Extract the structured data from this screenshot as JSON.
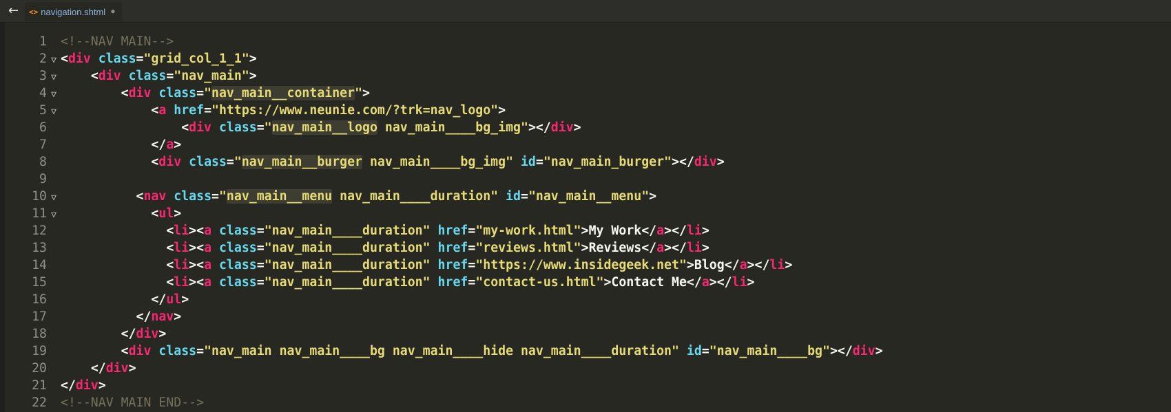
{
  "tab": {
    "title": "navigation.shtml",
    "icon": "code-file-icon",
    "modified": true
  },
  "toolbar": {
    "back_icon": "left-arrow-icon"
  },
  "theme": {
    "background": "#272822",
    "tag": "#f92672",
    "attribute": "#66d9ef",
    "string": "#e6db74",
    "comment": "#75715e",
    "text": "#f8f8f2"
  },
  "code": {
    "lines": [
      {
        "num": "1",
        "fold": false,
        "indent": 0,
        "tokens": [
          {
            "t": "com",
            "v": "<!--NAV MAIN-->"
          }
        ]
      },
      {
        "num": "2",
        "fold": true,
        "indent": 0,
        "tokens": [
          {
            "t": "pun",
            "v": "<"
          },
          {
            "t": "tag",
            "v": "div"
          },
          {
            "t": "pun",
            "v": " "
          },
          {
            "t": "attr",
            "v": "class"
          },
          {
            "t": "pun",
            "v": "="
          },
          {
            "t": "str",
            "v": "\"grid_col_1_1\""
          },
          {
            "t": "pun",
            "v": ">"
          }
        ]
      },
      {
        "num": "3",
        "fold": true,
        "indent": 4,
        "tokens": [
          {
            "t": "pun",
            "v": "<"
          },
          {
            "t": "tag",
            "v": "div"
          },
          {
            "t": "pun",
            "v": " "
          },
          {
            "t": "attr",
            "v": "class"
          },
          {
            "t": "pun",
            "v": "="
          },
          {
            "t": "str",
            "v": "\"nav_main\""
          },
          {
            "t": "pun",
            "v": ">"
          }
        ]
      },
      {
        "num": "4",
        "fold": true,
        "indent": 8,
        "tokens": [
          {
            "t": "pun",
            "v": "<"
          },
          {
            "t": "tag",
            "v": "div"
          },
          {
            "t": "pun",
            "v": " "
          },
          {
            "t": "attr",
            "v": "class"
          },
          {
            "t": "pun",
            "v": "="
          },
          {
            "t": "str",
            "v": "\""
          },
          {
            "t": "str",
            "v": "nav_main__container",
            "hl": true
          },
          {
            "t": "str",
            "v": "\""
          },
          {
            "t": "pun",
            "v": ">"
          }
        ]
      },
      {
        "num": "5",
        "fold": true,
        "indent": 12,
        "tokens": [
          {
            "t": "pun",
            "v": "<"
          },
          {
            "t": "tag",
            "v": "a"
          },
          {
            "t": "pun",
            "v": " "
          },
          {
            "t": "attr",
            "v": "href"
          },
          {
            "t": "pun",
            "v": "="
          },
          {
            "t": "str",
            "v": "\"https://www.neunie.com/?trk=nav_logo\""
          },
          {
            "t": "pun",
            "v": ">"
          }
        ]
      },
      {
        "num": "6",
        "fold": false,
        "indent": 16,
        "tokens": [
          {
            "t": "pun",
            "v": "<"
          },
          {
            "t": "tag",
            "v": "div"
          },
          {
            "t": "pun",
            "v": " "
          },
          {
            "t": "attr",
            "v": "class"
          },
          {
            "t": "pun",
            "v": "="
          },
          {
            "t": "str",
            "v": "\""
          },
          {
            "t": "str",
            "v": "nav_main__logo",
            "hl": true
          },
          {
            "t": "str",
            "v": " nav_main____bg_img\""
          },
          {
            "t": "pun",
            "v": "></"
          },
          {
            "t": "tag",
            "v": "div"
          },
          {
            "t": "pun",
            "v": ">"
          }
        ]
      },
      {
        "num": "7",
        "fold": false,
        "indent": 12,
        "tokens": [
          {
            "t": "pun",
            "v": "</"
          },
          {
            "t": "tag",
            "v": "a"
          },
          {
            "t": "pun",
            "v": ">"
          }
        ]
      },
      {
        "num": "8",
        "fold": false,
        "indent": 12,
        "tokens": [
          {
            "t": "pun",
            "v": "<"
          },
          {
            "t": "tag",
            "v": "div"
          },
          {
            "t": "pun",
            "v": " "
          },
          {
            "t": "attr",
            "v": "class"
          },
          {
            "t": "pun",
            "v": "="
          },
          {
            "t": "str",
            "v": "\""
          },
          {
            "t": "str",
            "v": "nav_main__burger",
            "hl": true
          },
          {
            "t": "str",
            "v": " nav_main____bg_img\""
          },
          {
            "t": "pun",
            "v": " "
          },
          {
            "t": "attr",
            "v": "id"
          },
          {
            "t": "pun",
            "v": "="
          },
          {
            "t": "str",
            "v": "\"nav_main_burger\""
          },
          {
            "t": "pun",
            "v": "></"
          },
          {
            "t": "tag",
            "v": "div"
          },
          {
            "t": "pun",
            "v": ">"
          }
        ]
      },
      {
        "num": "9",
        "fold": false,
        "indent": 0,
        "tokens": []
      },
      {
        "num": "10",
        "fold": true,
        "indent": 10,
        "tokens": [
          {
            "t": "pun",
            "v": "<"
          },
          {
            "t": "tag",
            "v": "nav"
          },
          {
            "t": "pun",
            "v": " "
          },
          {
            "t": "attr",
            "v": "class"
          },
          {
            "t": "pun",
            "v": "="
          },
          {
            "t": "str",
            "v": "\""
          },
          {
            "t": "str",
            "v": "nav_main__menu",
            "hl": true
          },
          {
            "t": "str",
            "v": " nav_main____duration\""
          },
          {
            "t": "pun",
            "v": " "
          },
          {
            "t": "attr",
            "v": "id"
          },
          {
            "t": "pun",
            "v": "="
          },
          {
            "t": "str",
            "v": "\"nav_main__menu\""
          },
          {
            "t": "pun",
            "v": ">"
          }
        ]
      },
      {
        "num": "11",
        "fold": true,
        "indent": 12,
        "tokens": [
          {
            "t": "pun",
            "v": "<"
          },
          {
            "t": "tag",
            "v": "ul"
          },
          {
            "t": "pun",
            "v": ">"
          }
        ]
      },
      {
        "num": "12",
        "fold": false,
        "indent": 14,
        "tokens": [
          {
            "t": "pun",
            "v": "<"
          },
          {
            "t": "tag",
            "v": "li"
          },
          {
            "t": "pun",
            "v": "><"
          },
          {
            "t": "tag",
            "v": "a"
          },
          {
            "t": "pun",
            "v": " "
          },
          {
            "t": "attr",
            "v": "class"
          },
          {
            "t": "pun",
            "v": "="
          },
          {
            "t": "str",
            "v": "\"nav_main____duration\""
          },
          {
            "t": "pun",
            "v": " "
          },
          {
            "t": "attr",
            "v": "href"
          },
          {
            "t": "pun",
            "v": "="
          },
          {
            "t": "str",
            "v": "\"my-work.html\""
          },
          {
            "t": "pun",
            "v": ">"
          },
          {
            "t": "txt",
            "v": "My Work"
          },
          {
            "t": "pun",
            "v": "</"
          },
          {
            "t": "tag",
            "v": "a"
          },
          {
            "t": "pun",
            "v": "></"
          },
          {
            "t": "tag",
            "v": "li"
          },
          {
            "t": "pun",
            "v": ">"
          }
        ]
      },
      {
        "num": "13",
        "fold": false,
        "indent": 14,
        "tokens": [
          {
            "t": "pun",
            "v": "<"
          },
          {
            "t": "tag",
            "v": "li"
          },
          {
            "t": "pun",
            "v": "><"
          },
          {
            "t": "tag",
            "v": "a"
          },
          {
            "t": "pun",
            "v": " "
          },
          {
            "t": "attr",
            "v": "class"
          },
          {
            "t": "pun",
            "v": "="
          },
          {
            "t": "str",
            "v": "\"nav_main____duration\""
          },
          {
            "t": "pun",
            "v": " "
          },
          {
            "t": "attr",
            "v": "href"
          },
          {
            "t": "pun",
            "v": "="
          },
          {
            "t": "str",
            "v": "\"reviews.html\""
          },
          {
            "t": "pun",
            "v": ">"
          },
          {
            "t": "txt",
            "v": "Reviews"
          },
          {
            "t": "pun",
            "v": "</"
          },
          {
            "t": "tag",
            "v": "a"
          },
          {
            "t": "pun",
            "v": "></"
          },
          {
            "t": "tag",
            "v": "li"
          },
          {
            "t": "pun",
            "v": ">"
          }
        ]
      },
      {
        "num": "14",
        "fold": false,
        "indent": 14,
        "tokens": [
          {
            "t": "pun",
            "v": "<"
          },
          {
            "t": "tag",
            "v": "li"
          },
          {
            "t": "pun",
            "v": "><"
          },
          {
            "t": "tag",
            "v": "a"
          },
          {
            "t": "pun",
            "v": " "
          },
          {
            "t": "attr",
            "v": "class"
          },
          {
            "t": "pun",
            "v": "="
          },
          {
            "t": "str",
            "v": "\"nav_main____duration\""
          },
          {
            "t": "pun",
            "v": " "
          },
          {
            "t": "attr",
            "v": "href"
          },
          {
            "t": "pun",
            "v": "="
          },
          {
            "t": "str",
            "v": "\"https://www.insidegeek.net\""
          },
          {
            "t": "pun",
            "v": ">"
          },
          {
            "t": "txt",
            "v": "Blog"
          },
          {
            "t": "pun",
            "v": "</"
          },
          {
            "t": "tag",
            "v": "a"
          },
          {
            "t": "pun",
            "v": "></"
          },
          {
            "t": "tag",
            "v": "li"
          },
          {
            "t": "pun",
            "v": ">"
          }
        ]
      },
      {
        "num": "15",
        "fold": false,
        "indent": 14,
        "tokens": [
          {
            "t": "pun",
            "v": "<"
          },
          {
            "t": "tag",
            "v": "li"
          },
          {
            "t": "pun",
            "v": "><"
          },
          {
            "t": "tag",
            "v": "a"
          },
          {
            "t": "pun",
            "v": " "
          },
          {
            "t": "attr",
            "v": "class"
          },
          {
            "t": "pun",
            "v": "="
          },
          {
            "t": "str",
            "v": "\"nav_main____duration\""
          },
          {
            "t": "pun",
            "v": " "
          },
          {
            "t": "attr",
            "v": "href"
          },
          {
            "t": "pun",
            "v": "="
          },
          {
            "t": "str",
            "v": "\"contact-us.html\""
          },
          {
            "t": "pun",
            "v": ">"
          },
          {
            "t": "txt",
            "v": "Contact Me"
          },
          {
            "t": "pun",
            "v": "</"
          },
          {
            "t": "tag",
            "v": "a"
          },
          {
            "t": "pun",
            "v": "></"
          },
          {
            "t": "tag",
            "v": "li"
          },
          {
            "t": "pun",
            "v": ">"
          }
        ]
      },
      {
        "num": "16",
        "fold": false,
        "indent": 12,
        "tokens": [
          {
            "t": "pun",
            "v": "</"
          },
          {
            "t": "tag",
            "v": "ul"
          },
          {
            "t": "pun",
            "v": ">"
          }
        ]
      },
      {
        "num": "17",
        "fold": false,
        "indent": 10,
        "tokens": [
          {
            "t": "pun",
            "v": "</"
          },
          {
            "t": "tag",
            "v": "nav"
          },
          {
            "t": "pun",
            "v": ">"
          }
        ]
      },
      {
        "num": "18",
        "fold": false,
        "indent": 8,
        "tokens": [
          {
            "t": "pun",
            "v": "</"
          },
          {
            "t": "tag",
            "v": "div"
          },
          {
            "t": "pun",
            "v": ">"
          }
        ]
      },
      {
        "num": "19",
        "fold": false,
        "indent": 8,
        "tokens": [
          {
            "t": "pun",
            "v": "<"
          },
          {
            "t": "tag",
            "v": "div"
          },
          {
            "t": "pun",
            "v": " "
          },
          {
            "t": "attr",
            "v": "class"
          },
          {
            "t": "pun",
            "v": "="
          },
          {
            "t": "str",
            "v": "\"nav_main nav_main____bg nav_main____hide nav_main____duration\""
          },
          {
            "t": "pun",
            "v": " "
          },
          {
            "t": "attr",
            "v": "id"
          },
          {
            "t": "pun",
            "v": "="
          },
          {
            "t": "str",
            "v": "\"nav_main____bg\""
          },
          {
            "t": "pun",
            "v": "></"
          },
          {
            "t": "tag",
            "v": "div"
          },
          {
            "t": "pun",
            "v": ">"
          }
        ]
      },
      {
        "num": "20",
        "fold": false,
        "indent": 4,
        "tokens": [
          {
            "t": "pun",
            "v": "</"
          },
          {
            "t": "tag",
            "v": "div"
          },
          {
            "t": "pun",
            "v": ">"
          }
        ]
      },
      {
        "num": "21",
        "fold": false,
        "indent": 0,
        "tokens": [
          {
            "t": "pun",
            "v": "</"
          },
          {
            "t": "tag",
            "v": "div"
          },
          {
            "t": "pun",
            "v": ">"
          }
        ]
      },
      {
        "num": "22",
        "fold": false,
        "indent": 0,
        "tokens": [
          {
            "t": "com",
            "v": "<!--NAV MAIN END-->"
          }
        ]
      }
    ]
  }
}
